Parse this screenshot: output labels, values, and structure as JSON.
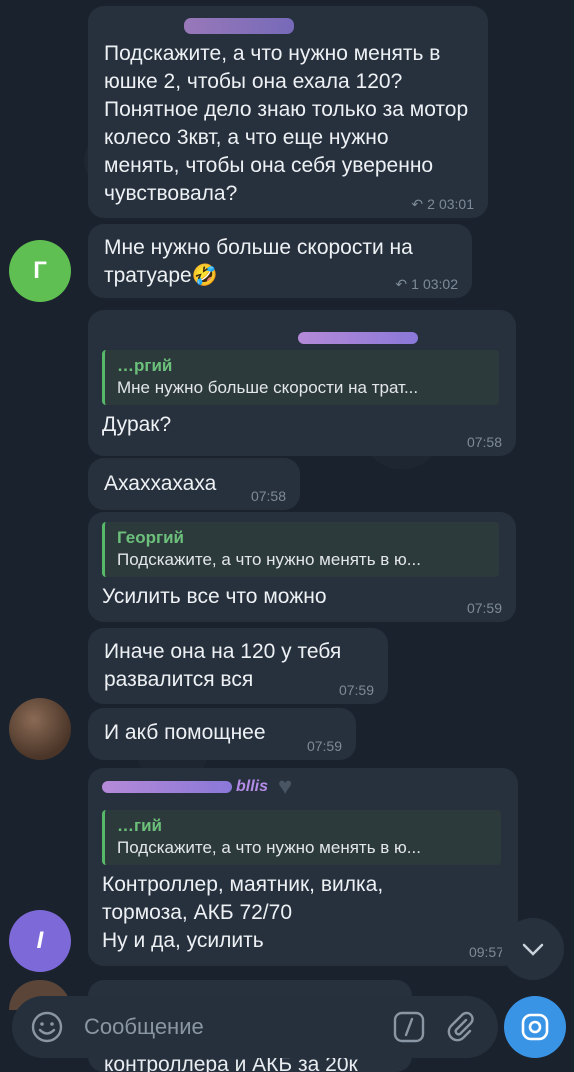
{
  "messages": {
    "m1": {
      "text": "Подскажите, а что нужно менять в юшке 2, чтобы она ехала 120? Понятное дело знаю только за мотор колесо 3квт, а что еще нужно менять, чтобы она себя уверенно чувствовала?",
      "replies": "2",
      "time": "03:01"
    },
    "m2": {
      "text": "Мне нужно больше скорости на тратуаре🤣",
      "replies": "1",
      "time": "03:02",
      "avatar_letter": "Г"
    },
    "m3": {
      "quote_author": "…ргий",
      "quote_text": "Мне нужно больше скорости на трат...",
      "text": "Дурак?",
      "time": "07:58"
    },
    "m4": {
      "text": "Ахаххахаха",
      "time": "07:58"
    },
    "m5": {
      "quote_author": "Георгий",
      "quote_text": "Подскажите, а что нужно менять в ю...",
      "text": "Усилить все что можно",
      "time": "07:59"
    },
    "m6": {
      "text": "Иначе она на 120 у тебя развалится вся",
      "time": "07:59"
    },
    "m7": {
      "text": "И акб помощнее",
      "time": "07:59"
    },
    "m8": {
      "sender_tail": "bllis",
      "quote_author": "…гий",
      "quote_text": "Подскажите, а что нужно менять в ю...",
      "text": "Контроллер, маятник, вилка, тормоза, АКБ 72/70\nНу и да, усилить",
      "time": "09:57",
      "avatar_letter": "I"
    }
  },
  "composer": {
    "placeholder": "Сообщение",
    "peek_text": "контроллера и АКБ за 20к"
  },
  "icons": {
    "emoji": "emoji-icon",
    "command": "slash-command-icon",
    "attach": "paperclip-icon",
    "camera": "camera-icon",
    "scroll": "chevron-down-icon"
  },
  "colors": {
    "accent": "#3a94e6",
    "reply_bar": "#57b86a",
    "bubble": "#27313e"
  }
}
